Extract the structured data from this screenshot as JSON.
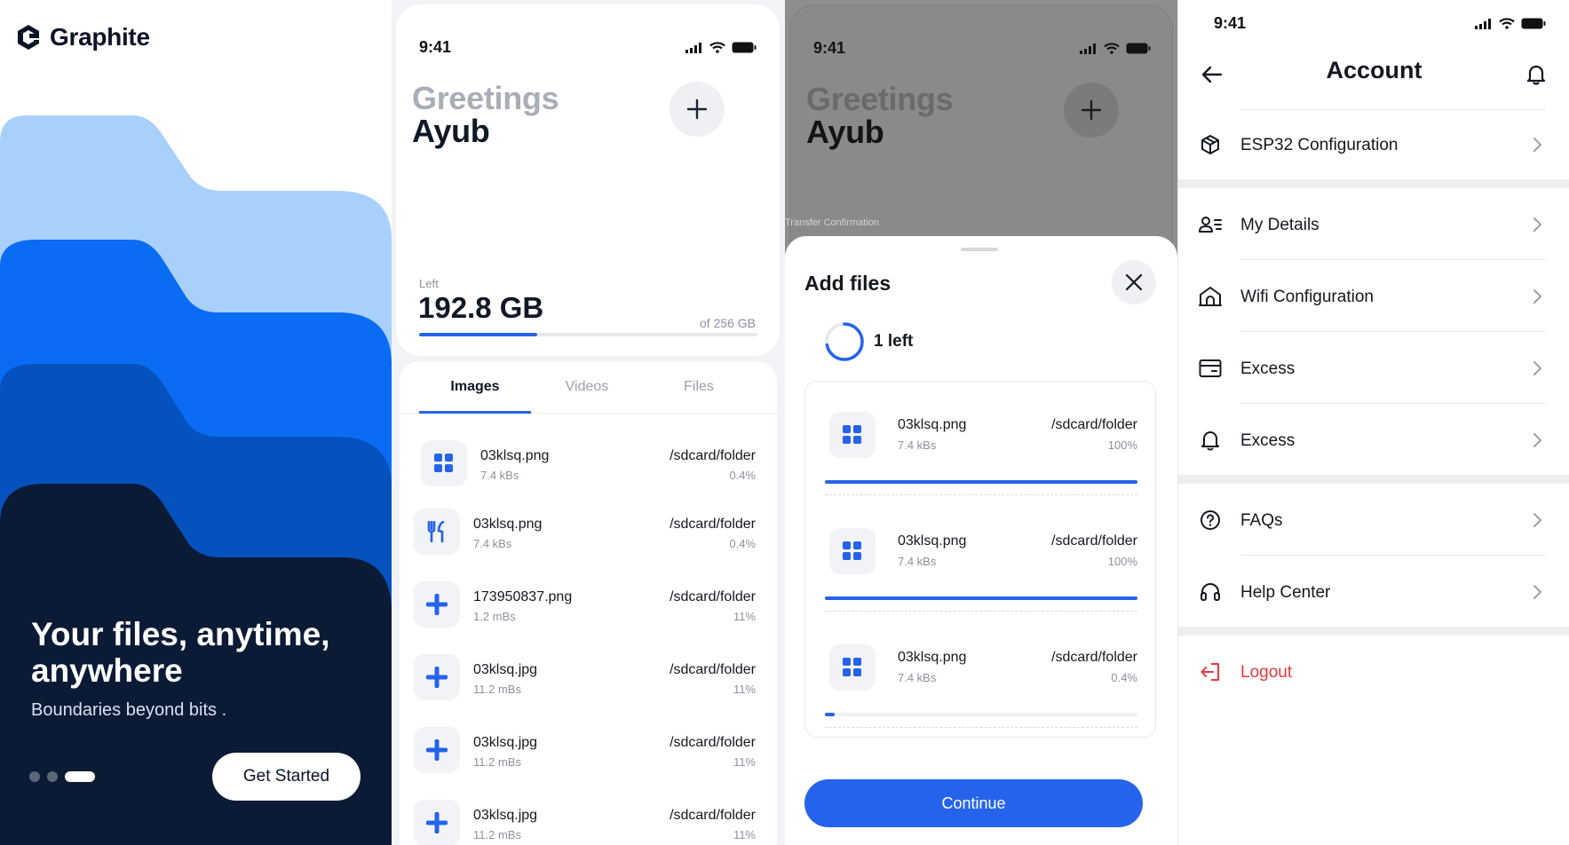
{
  "colors": {
    "accent": "#2563eb",
    "dark_navy": "#0b1a35",
    "danger": "#e5383b",
    "wave_light": "#a9d0fb",
    "wave_mid": "#0a6cf2",
    "wave_deep": "#0551bd"
  },
  "onboarding": {
    "brand": "Graphite",
    "headline": "Your files, anytime, anywhere",
    "subtitle": "Boundaries beyond bits .",
    "page_count": 3,
    "active_page": 3,
    "cta_label": "Get Started"
  },
  "home": {
    "status_time": "9:41",
    "greeting": "Greetings",
    "user_name": "Ayub",
    "add_icon": "plus-icon",
    "storage": {
      "left_label": "Left",
      "left_value": "192.8 GB",
      "total_label": "of 256 GB",
      "used_fraction": 0.35
    },
    "tabs": [
      {
        "label": "Images"
      },
      {
        "label": "Videos"
      },
      {
        "label": "Files"
      }
    ],
    "active_tab": "Images",
    "files": [
      {
        "name": "03klsq.png",
        "size": "7.4 kBs",
        "path": "/sdcard/folder",
        "progress": "0.4%",
        "icon": "grid-icon"
      },
      {
        "name": "03klsq.png",
        "size": "7.4 kBs",
        "path": "/sdcard/folder",
        "progress": "0.4%",
        "icon": "utensils-icon"
      },
      {
        "name": "173950837.png",
        "size": "1.2 mBs",
        "path": "/sdcard/folder",
        "progress": "11%",
        "icon": "plus-icon"
      },
      {
        "name": "03klsq.jpg",
        "size": "11.2 mBs",
        "path": "/sdcard/folder",
        "progress": "11%",
        "icon": "plus-icon"
      },
      {
        "name": "03klsq.jpg",
        "size": "11.2 mBs",
        "path": "/sdcard/folder",
        "progress": "11%",
        "icon": "plus-icon"
      },
      {
        "name": "03klsq.jpg",
        "size": "11.2 mBs",
        "path": "/sdcard/folder",
        "progress": "11%",
        "icon": "plus-icon"
      }
    ]
  },
  "modal": {
    "status_time": "9:41",
    "greeting": "Greetings",
    "user_name": "Ayub",
    "overlay_label": "Transfer Confirmation",
    "title": "Add files",
    "remaining": "1 left",
    "ring_fraction": 0.72,
    "uploads": [
      {
        "name": "03klsq.png",
        "size": "7.4 kBs",
        "path": "/sdcard/folder",
        "progress_label": "100%",
        "progress": 1.0
      },
      {
        "name": "03klsq.png",
        "size": "7.4 kBs",
        "path": "/sdcard/folder",
        "progress_label": "100%",
        "progress": 1.0
      },
      {
        "name": "03klsq.png",
        "size": "7.4 kBs",
        "path": "/sdcard/folder",
        "progress_label": "0.4%",
        "progress": 0.004
      }
    ],
    "continue_label": "Continue"
  },
  "account": {
    "status_time": "9:41",
    "title": "Account",
    "back_icon": "arrow-left-icon",
    "notification_icon": "bell-icon",
    "items": [
      {
        "label": "ESP32 Configuration",
        "icon": "cube-icon"
      },
      {
        "label": "My Details",
        "icon": "user-list-icon"
      },
      {
        "label": "Wifi Configuration",
        "icon": "home-icon"
      },
      {
        "label": "Excess",
        "icon": "card-icon"
      },
      {
        "label": "Excess",
        "icon": "bell-icon"
      },
      {
        "label": "FAQs",
        "icon": "question-icon"
      },
      {
        "label": "Help Center",
        "icon": "headset-icon"
      },
      {
        "label": "Logout",
        "icon": "logout-icon"
      }
    ]
  }
}
